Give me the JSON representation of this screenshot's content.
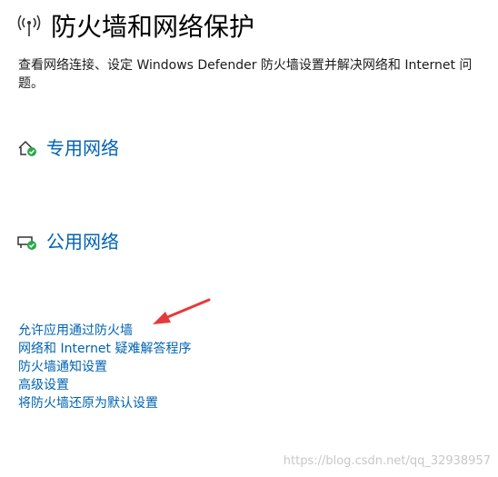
{
  "header": {
    "icon": "antenna-signal-icon",
    "title": "防火墙和网络保护"
  },
  "description": "查看网络连接、设定 Windows Defender 防火墙设置并解决网络和 Internet 问题。",
  "networks": [
    {
      "icon": "private-network-house-check-icon",
      "label": "专用网络",
      "status_color": "#2aa84a"
    },
    {
      "icon": "public-network-bench-check-icon",
      "label": "公用网络",
      "status_color": "#2aa84a"
    }
  ],
  "links": [
    "允许应用通过防火墙",
    "网络和 Internet 疑难解答程序",
    "防火墙通知设置",
    "高级设置",
    "将防火墙还原为默认设置"
  ],
  "annotation": {
    "icon": "red-arrow-icon",
    "color": "#e8383d"
  },
  "watermark": "https://blog.csdn.net/qq_32938957",
  "colors": {
    "link": "#0063b1",
    "title": "#000000",
    "background": "#ffffff"
  }
}
